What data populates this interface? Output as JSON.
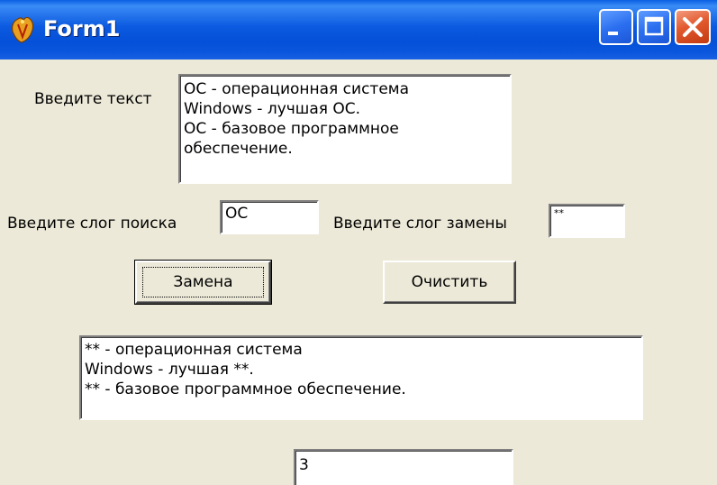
{
  "window": {
    "title": "Form1",
    "icon": "delphi-app-icon",
    "controls": [
      "minimize-icon",
      "maximize-icon",
      "close-icon"
    ]
  },
  "form": {
    "input_label": "Введите текст",
    "input_lines": [
      "ОС - операционная система",
      "Windows - лучшая ОС.",
      "ОС - базовое программное",
      "обеспечение."
    ],
    "search_label": "Введите слог поиска",
    "search_value": "ОС",
    "replace_label": "Введите слог замены",
    "replace_value": "**",
    "replace_button": "Замена",
    "clear_button": "Очистить",
    "output_lines": [
      "** - операционная система",
      "Windows - лучшая **.",
      "** - базовое программное обеспечение."
    ],
    "count_value": "3"
  }
}
